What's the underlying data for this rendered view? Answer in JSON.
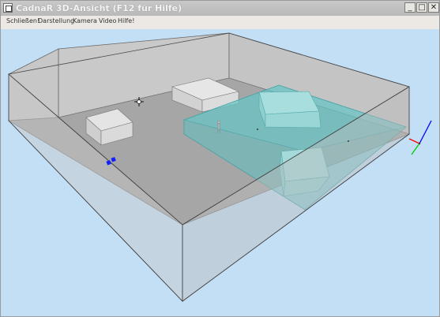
{
  "window": {
    "title": "CadnaR 3D-Ansicht (F12 für Hilfe)",
    "controls": {
      "minimize": "_",
      "maximize": "□",
      "close": "✕"
    }
  },
  "menu": {
    "items": [
      {
        "label": "Schließen!"
      },
      {
        "label": "Darstellung"
      },
      {
        "label": "Kamera"
      },
      {
        "label": "Video"
      },
      {
        "label": "Hilfe!"
      }
    ]
  },
  "viewport": {
    "background_color": "#c3dff6",
    "floor_color": "#a4a4a4",
    "wall_color": "#c6c6c6",
    "area_color": "#74c7c7",
    "axes": {
      "x_color": "#ff0000",
      "y_color": "#00cc00",
      "z_color": "#0000ff"
    },
    "icons": [
      "cursor-icon",
      "person-icon",
      "source-marker-icon",
      "axis-gizmo-icon"
    ]
  }
}
